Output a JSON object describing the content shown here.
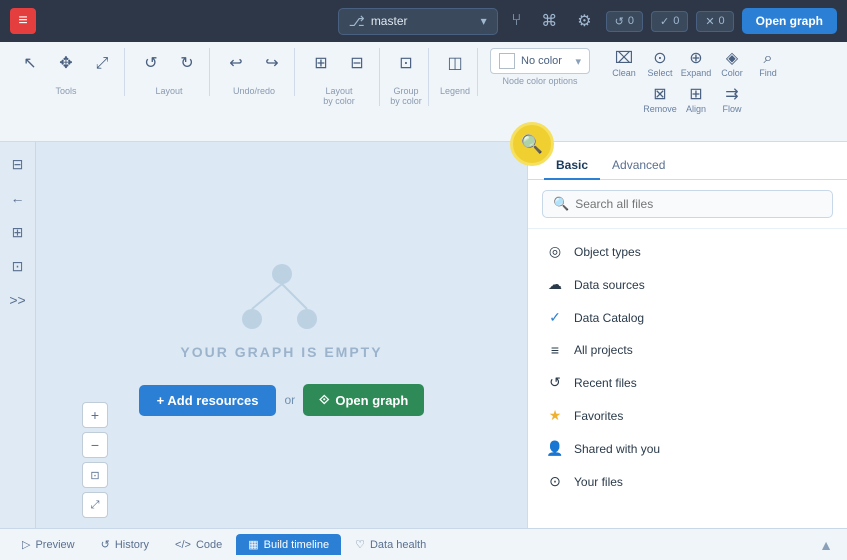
{
  "app": {
    "logo": "≡",
    "branch": "master"
  },
  "topnav": {
    "branch_label": "master",
    "counter1": "↺ 0",
    "counter2": "✓ 0",
    "counter3": "✕ 0",
    "open_graph_label": "Open graph"
  },
  "toolbar": {
    "groups": [
      {
        "name": "Tools",
        "tools": [
          {
            "icon": "↖",
            "label": ""
          },
          {
            "icon": "✥",
            "label": ""
          },
          {
            "icon": "⤢",
            "label": ""
          }
        ]
      },
      {
        "name": "Layout",
        "tools": [
          {
            "icon": "↺",
            "label": ""
          },
          {
            "icon": "↻",
            "label": ""
          }
        ]
      },
      {
        "name": "Undo/redo",
        "tools": []
      },
      {
        "name": "Layout by color",
        "tools": [
          {
            "icon": "⊞",
            "label": ""
          },
          {
            "icon": "⊟",
            "label": ""
          }
        ]
      },
      {
        "name": "Group by color",
        "tools": []
      },
      {
        "name": "Legend",
        "tools": [
          {
            "icon": "◫",
            "label": ""
          }
        ]
      }
    ],
    "node_color_label": "Node color options",
    "color_option": "No color",
    "toolbar_items": [
      {
        "icon": "⌧",
        "label": "Clean"
      },
      {
        "icon": "⊙",
        "label": "Select"
      },
      {
        "icon": "⊕",
        "label": "Expand"
      },
      {
        "icon": "◈",
        "label": "Color"
      },
      {
        "icon": "⌕",
        "label": "Find"
      },
      {
        "icon": "⊠",
        "label": "Remove"
      },
      {
        "icon": "⊞",
        "label": "Align"
      },
      {
        "icon": "⇉",
        "label": "Flow"
      }
    ]
  },
  "canvas": {
    "empty_message": "YOUR GRAPH IS EMPTY",
    "add_resources_label": "+ Add resources",
    "or_label": "or",
    "open_graph_label": "⟐ Open graph"
  },
  "right_panel": {
    "tabs": [
      {
        "label": "Basic",
        "active": true
      },
      {
        "label": "Advanced",
        "active": false
      }
    ],
    "search_placeholder": "Search all files",
    "items": [
      {
        "icon": "◎",
        "label": "Object types"
      },
      {
        "icon": "☁",
        "label": "Data sources"
      },
      {
        "icon": "✓",
        "label": "Data Catalog"
      },
      {
        "icon": "≡",
        "label": "All projects"
      },
      {
        "icon": "↺",
        "label": "Recent files"
      },
      {
        "icon": "★",
        "label": "Favorites"
      },
      {
        "icon": "👤",
        "label": "Shared with you"
      },
      {
        "icon": "⊙",
        "label": "Your files"
      }
    ]
  },
  "bottom_bar": {
    "tabs": [
      {
        "icon": "▷",
        "label": "Preview",
        "active": false
      },
      {
        "icon": "↺",
        "label": "History",
        "active": false
      },
      {
        "icon": "<>",
        "label": "Code",
        "active": false
      },
      {
        "icon": "▦",
        "label": "Build timeline",
        "active": true
      },
      {
        "icon": "♡",
        "label": "Data health",
        "active": false
      }
    ]
  }
}
